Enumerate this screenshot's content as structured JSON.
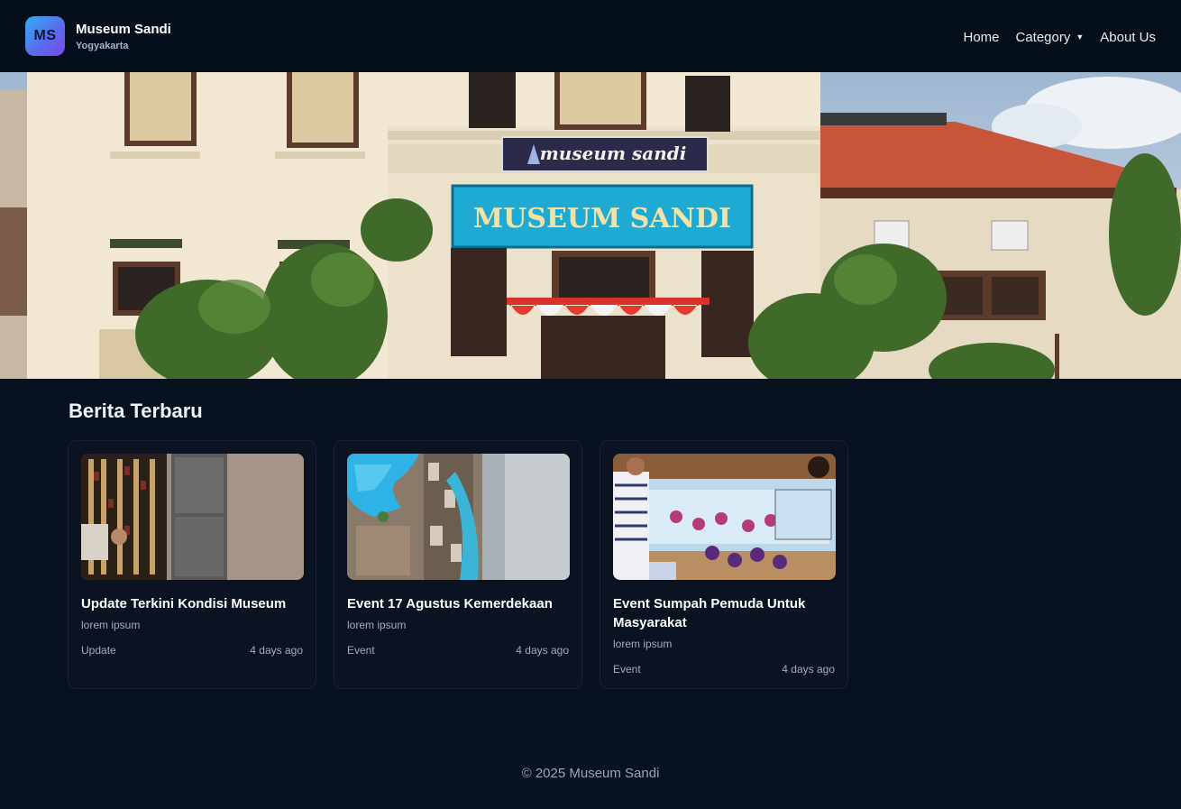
{
  "navbar": {
    "logo_text": "MS",
    "brand_title": "Museum Sandi",
    "brand_subtitle": "Yogyakarta",
    "links": {
      "home": "Home",
      "category": "Category",
      "category_caret": "▼",
      "about": "About Us"
    }
  },
  "hero": {
    "sign_top": "museum sandi",
    "sign_main": "MUSEUM SANDI"
  },
  "news": {
    "title": "Berita Terbaru",
    "cards": [
      {
        "title": "Update Terkini Kondisi Museum",
        "desc": "lorem ipsum",
        "category": "Update",
        "time": "4 days ago"
      },
      {
        "title": "Event 17 Agustus Kemerdekaan",
        "desc": "lorem ipsum",
        "category": "Event",
        "time": "4 days ago"
      },
      {
        "title": "Event Sumpah Pemuda Untuk Masyarakat",
        "desc": "lorem ipsum",
        "category": "Event",
        "time": "4 days ago"
      }
    ]
  },
  "footer": {
    "text": "© 2025 Museum Sandi"
  },
  "colors": {
    "background": "#07111f",
    "navbar": "#050e1b",
    "card": "#0b1322",
    "logo_gradient_start": "#2fb0f0",
    "logo_gradient_end": "#7b45e6"
  }
}
